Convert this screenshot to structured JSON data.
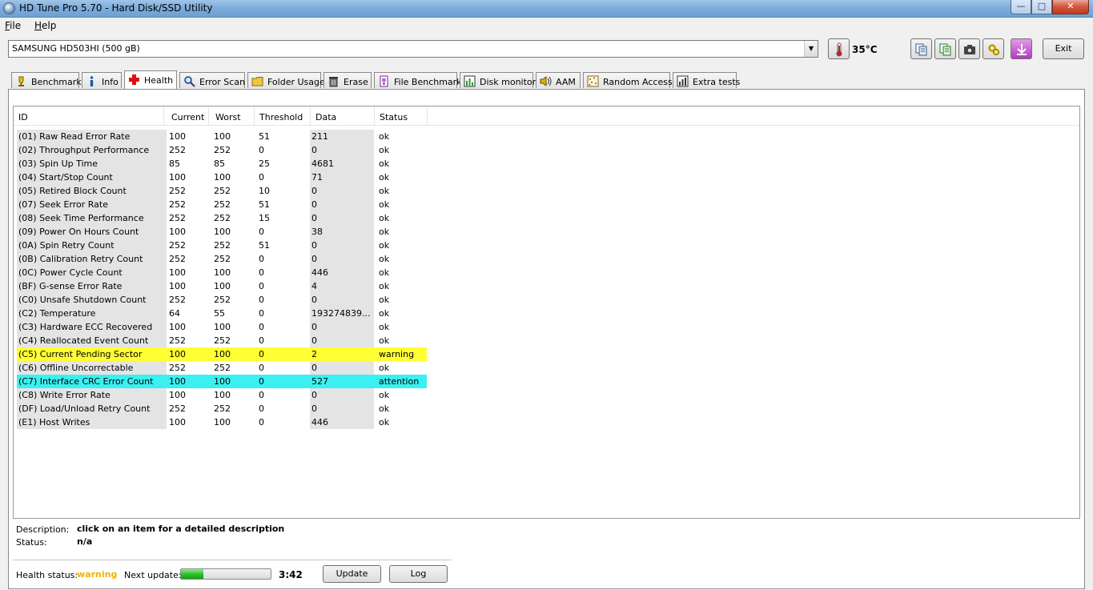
{
  "window": {
    "title": "HD Tune Pro 5.70 - Hard Disk/SSD Utility"
  },
  "menu": [
    {
      "label": "File",
      "underline": "F",
      "rest": "ile"
    },
    {
      "label": "Help",
      "underline": "H",
      "rest": "elp"
    }
  ],
  "toolbar": {
    "drive": "SAMSUNG HD503HI (500 gB)",
    "temperature": "35°C",
    "exit_label": "Exit"
  },
  "tabs": [
    {
      "label": "Benchmark",
      "icon": "benchmark-icon"
    },
    {
      "label": "Info",
      "icon": "info-icon"
    },
    {
      "label": "Health",
      "icon": "health-cross-icon",
      "active": true
    },
    {
      "label": "Error Scan",
      "icon": "error-scan-icon"
    },
    {
      "label": "Folder Usage",
      "icon": "folder-icon"
    },
    {
      "label": "Erase",
      "icon": "trash-icon"
    },
    {
      "label": "File Benchmark",
      "icon": "file-benchmark-icon"
    },
    {
      "label": "Disk monitor",
      "icon": "disk-monitor-icon"
    },
    {
      "label": "AAM",
      "icon": "speaker-icon"
    },
    {
      "label": "Random Access",
      "icon": "random-access-icon"
    },
    {
      "label": "Extra tests",
      "icon": "extra-tests-icon"
    }
  ],
  "table": {
    "headers": [
      "ID",
      "Current",
      "Worst",
      "Threshold",
      "Data",
      "Status"
    ],
    "rows": [
      [
        "(01) Raw Read Error Rate",
        "100",
        "100",
        "51",
        "211",
        "ok"
      ],
      [
        "(02) Throughput Performance",
        "252",
        "252",
        "0",
        "0",
        "ok"
      ],
      [
        "(03) Spin Up Time",
        "85",
        "85",
        "25",
        "4681",
        "ok"
      ],
      [
        "(04) Start/Stop Count",
        "100",
        "100",
        "0",
        "71",
        "ok"
      ],
      [
        "(05) Retired Block Count",
        "252",
        "252",
        "10",
        "0",
        "ok"
      ],
      [
        "(07) Seek Error Rate",
        "252",
        "252",
        "51",
        "0",
        "ok"
      ],
      [
        "(08) Seek Time Performance",
        "252",
        "252",
        "15",
        "0",
        "ok"
      ],
      [
        "(09) Power On Hours Count",
        "100",
        "100",
        "0",
        "38",
        "ok"
      ],
      [
        "(0A) Spin Retry Count",
        "252",
        "252",
        "51",
        "0",
        "ok"
      ],
      [
        "(0B) Calibration Retry Count",
        "252",
        "252",
        "0",
        "0",
        "ok"
      ],
      [
        "(0C) Power Cycle Count",
        "100",
        "100",
        "0",
        "446",
        "ok"
      ],
      [
        "(BF) G-sense Error Rate",
        "100",
        "100",
        "0",
        "4",
        "ok"
      ],
      [
        "(C0) Unsafe Shutdown Count",
        "252",
        "252",
        "0",
        "0",
        "ok"
      ],
      [
        "(C2) Temperature",
        "64",
        "55",
        "0",
        "193274839...",
        "ok"
      ],
      [
        "(C3) Hardware ECC Recovered",
        "100",
        "100",
        "0",
        "0",
        "ok"
      ],
      [
        "(C4) Reallocated Event Count",
        "252",
        "252",
        "0",
        "0",
        "ok"
      ],
      [
        "(C5) Current Pending Sector",
        "100",
        "100",
        "0",
        "2",
        "warning"
      ],
      [
        "(C6) Offline Uncorrectable",
        "252",
        "252",
        "0",
        "0",
        "ok"
      ],
      [
        "(C7) Interface CRC Error Count",
        "100",
        "100",
        "0",
        "527",
        "attention"
      ],
      [
        "(C8) Write Error Rate",
        "100",
        "100",
        "0",
        "0",
        "ok"
      ],
      [
        "(DF) Load/Unload Retry Count",
        "252",
        "252",
        "0",
        "0",
        "ok"
      ],
      [
        "(E1) Host Writes",
        "100",
        "100",
        "0",
        "446",
        "ok"
      ]
    ]
  },
  "details": {
    "description_label": "Description:",
    "description_value": "click on an item for a detailed description",
    "status_label": "Status:",
    "status_value": "n/a"
  },
  "footer": {
    "health_label": "Health status:",
    "health_value": "warning",
    "next_update_label": "Next update:",
    "progress_fraction": 0.25,
    "time_left": "3:42",
    "update_label": "Update",
    "log_label": "Log"
  },
  "colors": {
    "warning_row": "#ffff33",
    "attention_row": "#3af0f0",
    "health_warning_text": "#f0b400"
  }
}
